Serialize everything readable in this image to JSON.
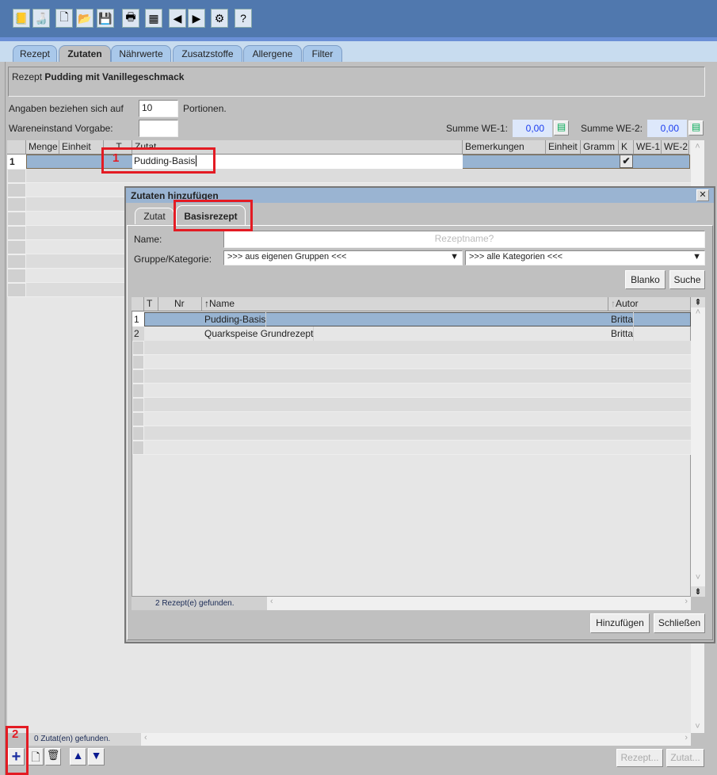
{
  "toolbar": {
    "icons": [
      "book-icon",
      "bottles-icon",
      "new-document-icon",
      "open-folder-icon",
      "save-icon",
      "print-icon",
      "add-table-icon",
      "arrow-left-icon",
      "arrow-right-icon",
      "gear-icon",
      "help-icon"
    ],
    "glyphs": [
      "📒",
      "🍶",
      "🗋",
      "📂",
      "💾",
      "🖶",
      "▦",
      "◀",
      "▶",
      "⚙",
      "?"
    ]
  },
  "tabs": [
    "Rezept",
    "Zutaten",
    "Nährwerte",
    "Zusatzstoffe",
    "Allergene",
    "Filter"
  ],
  "recipe": {
    "label": "Rezept",
    "name": "Pudding mit Vanillegeschmack"
  },
  "portions": {
    "label": "Angaben beziehen sich auf",
    "value": "10",
    "suffix": "Portionen."
  },
  "wareneinstand": {
    "label": "Wareneinstand Vorgabe:",
    "value": ""
  },
  "summe": {
    "we1_label": "Summe WE-1:",
    "we1_value": "0,00",
    "we2_label": "Summe WE-2:",
    "we2_value": "0,00"
  },
  "table": {
    "columns": [
      "Menge",
      "Einheit",
      "T",
      "Zutat",
      "Bemerkungen",
      "Einheit",
      "Gramm",
      "K",
      "WE-1",
      "WE-2"
    ],
    "rows": [
      {
        "num": "1",
        "zutat": "Pudding-Basis",
        "k": "✔"
      }
    ],
    "status": "0 Zutat(en) gefunden."
  },
  "bottom": {
    "rezept_btn": "Rezept...",
    "zutat_btn": "Zutat..."
  },
  "annotations": {
    "one": "1",
    "two": "2"
  },
  "dialog": {
    "title": "Zutaten hinzufügen",
    "close": "✕",
    "tabs": [
      "Zutat",
      "Basisrezept"
    ],
    "name_label": "Name:",
    "name_placeholder": "Rezeptname?",
    "gruppe_label": "Gruppe/Kategorie:",
    "gruppe_value": ">>> aus eigenen Gruppen <<<",
    "kategorie_value": ">>> alle Kategorien <<<",
    "blanko": "Blanko",
    "suche": "Suche",
    "columns": [
      "T",
      "Nr",
      "Name",
      "Autor"
    ],
    "rows": [
      {
        "num": "1",
        "name": "Pudding-Basis",
        "autor": "Britta"
      },
      {
        "num": "2",
        "name": "Quarkspeise Grundrezept",
        "autor": "Britta"
      }
    ],
    "status": "2  Rezept(e) gefunden.",
    "add": "Hinzufügen",
    "close_btn": "Schließen"
  }
}
